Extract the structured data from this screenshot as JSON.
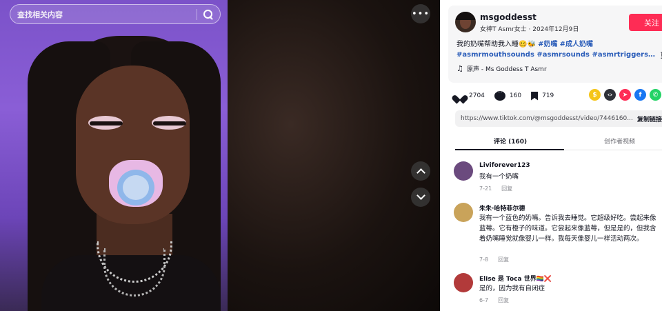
{
  "search": {
    "placeholder": "查找相关内容"
  },
  "video": {
    "more_label": "•••"
  },
  "post": {
    "username": "msgoddesst",
    "subtitle": "女神T Asmr女士 · 2024年12月9日",
    "follow_label": "关注",
    "description_text": "我的奶嘴帮助我入睡🥴🐝",
    "description_tags": [
      "#奶嘴",
      "#成人奶嘴"
    ],
    "description_tags_line2": "#asmrmouthsounds #asmrsounds #asmrtriggers…",
    "more_label": "更",
    "music_icon": "music-note-icon",
    "music": "原声 - Ms Goddess T Asmr",
    "likes": "2704",
    "comments": "160",
    "saves": "719",
    "share_icons": [
      {
        "name": "coin-icon",
        "color": "#f5c518",
        "glyph": "$"
      },
      {
        "name": "embed-icon",
        "color": "#2f3138",
        "glyph": "‹›"
      },
      {
        "name": "send-icon",
        "color": "#fe2c55",
        "glyph": "➤"
      },
      {
        "name": "facebook-icon",
        "color": "#1877f2",
        "glyph": "f"
      },
      {
        "name": "whatsapp-icon",
        "color": "#25d366",
        "glyph": "✆"
      }
    ],
    "link": "https://www.tiktok.com/@msgoddesst/video/7446160...",
    "copy_link_label": "复制链接"
  },
  "tabs": {
    "comments": "评论 (160)",
    "creator_videos": "创作者视频"
  },
  "comments": [
    {
      "user": "Liviforever123",
      "text": "我有一个奶嘴",
      "date": "7-21",
      "reply": "回复",
      "avatar_color": "#6b4a7e"
    },
    {
      "user": "朱朱·哈特菲尔德",
      "text": "我有一个蓝色的奶嘴。告诉我去睡觉。它超级好吃。尝起来像蓝莓。它有橙子的味道。它尝起来像蓝莓，但是是的，但我含着奶嘴睡觉就像婴儿一样。我每天像婴儿一样活动两次。",
      "date": "7-8",
      "reply": "回复",
      "avatar_color": "#c9a35a"
    },
    {
      "user": "Elise 是 Toca 世界🏳️‍🌈❌",
      "text": "是的，因为我有自闭症",
      "date": "6-7",
      "reply": "回复",
      "avatar_color": "#b23a3a"
    }
  ],
  "colors": {
    "accent": "#fe2c55",
    "hashtag": "#2b5db9"
  }
}
